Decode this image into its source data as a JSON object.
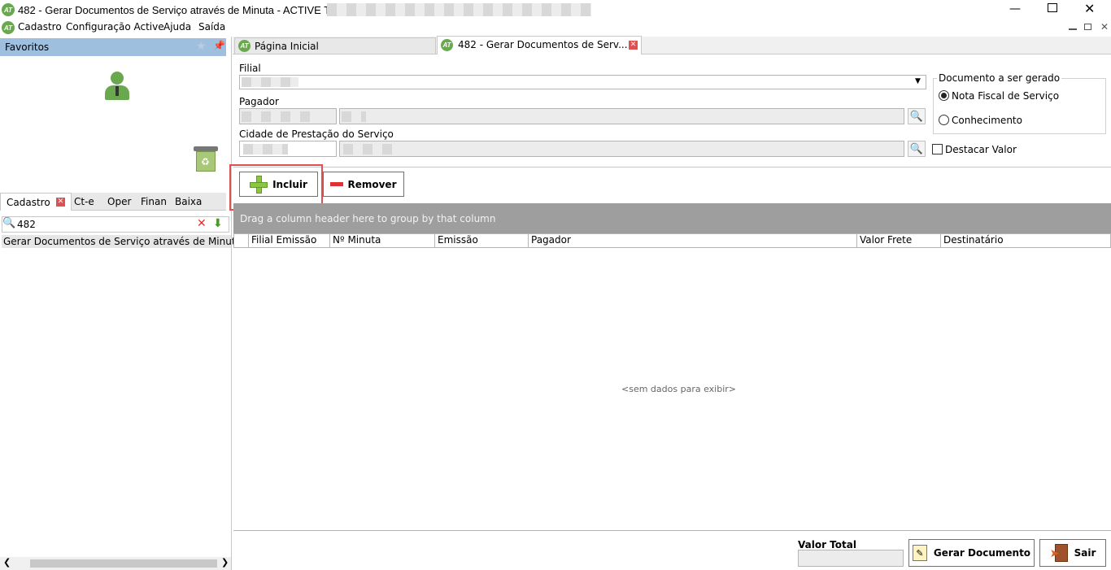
{
  "window": {
    "title": "482 - Gerar Documentos de Serviço através de Minuta - ACTIVE TRANS -",
    "logo_text": "AT"
  },
  "menu": [
    "Cadastro",
    "Configuração Active",
    "Ajuda",
    "Saída"
  ],
  "favorites": {
    "title": "Favoritos"
  },
  "side_tabs": [
    "Cadastro",
    "Ct-e",
    "Oper",
    "Finan",
    "Baixa"
  ],
  "side_search": {
    "value": "482"
  },
  "side_results": [
    "Gerar Documentos de Serviço através de Minuta"
  ],
  "doc_tabs": [
    "Página Inicial",
    "482 - Gerar Documentos de Serv..."
  ],
  "form": {
    "filial_label": "Filial",
    "pagador_label": "Pagador",
    "cidade_label": "Cidade de Prestação do Serviço"
  },
  "doc_group": {
    "title": "Documento a ser gerado",
    "options": [
      "Nota Fiscal de Serviço",
      "Conhecimento"
    ],
    "selected": 0
  },
  "destacar_label": "Destacar Valor",
  "buttons": {
    "incluir": "Incluir",
    "remover": "Remover",
    "gerar": "Gerar Documento",
    "sair": "Sair"
  },
  "grid": {
    "group_hint": "Drag a column header here to group by that column",
    "columns": [
      "Filial Emissão",
      "Nº Minuta",
      "Emissão",
      "Pagador",
      "Valor Frete",
      "Destinatário"
    ],
    "empty": "<sem dados para exibir>"
  },
  "footer": {
    "valor_total_label": "Valor Total"
  },
  "colors": {
    "accent_green": "#6aa84f",
    "highlight_red": "#e05050",
    "panel_header": "#9fbfdf"
  }
}
